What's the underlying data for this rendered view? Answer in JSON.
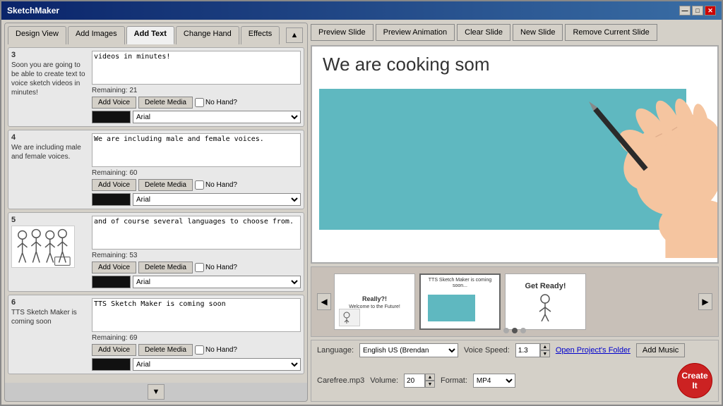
{
  "window": {
    "title": "SketchMaker",
    "buttons": {
      "minimize": "—",
      "maximize": "□",
      "close": "✕"
    }
  },
  "tabs": {
    "items": [
      "Design View",
      "Add Images",
      "Add Text",
      "Change Hand",
      "Effects"
    ],
    "active": "Add Text"
  },
  "toolbar": {
    "preview_slide": "Preview Slide",
    "preview_animation": "Preview Animation",
    "clear_slide": "Clear Slide",
    "new_slide": "New Slide",
    "remove_slide": "Remove Current Slide"
  },
  "slides": [
    {
      "number": "3",
      "left_text": "Soon you are going to be able to create text to voice sketch videos in minutes!",
      "textarea": "videos in minutes!",
      "remaining": "Remaining: 21",
      "font": "Arial",
      "has_image": false
    },
    {
      "number": "4",
      "left_text": "We are including male and female voices.",
      "textarea": "We are including male and female voices.",
      "remaining": "Remaining: 60",
      "font": "Arial",
      "has_image": false
    },
    {
      "number": "5",
      "left_text": "",
      "textarea": "and of course several languages to choose from.",
      "remaining": "Remaining: 53",
      "font": "Arial",
      "has_image": true
    },
    {
      "number": "6",
      "left_text": "TTS Sketch Maker is coming soon",
      "textarea": "TTS Sketch Maker is coming soon",
      "remaining": "Remaining: 69",
      "font": "Arial",
      "has_image": false
    }
  ],
  "preview": {
    "text": "We are cooking som"
  },
  "thumbnails": [
    {
      "label": "Really?!\nWelcome to the Future!",
      "type": "text"
    },
    {
      "label": "TTS Sketch Maker is coming soon...",
      "type": "teal"
    },
    {
      "label": "Get Ready!",
      "type": "figure"
    }
  ],
  "dots": [
    false,
    true,
    false
  ],
  "bottom_bar": {
    "language_label": "Language:",
    "language_value": "English US (Brendan",
    "voice_speed_label": "Voice Speed:",
    "voice_speed_value": "1.3",
    "open_folder": "Open Project's Folder",
    "add_music": "Add Music",
    "music_file": "Carefree.mp3",
    "volume_label": "Volume:",
    "volume_value": "20",
    "format_label": "Format:",
    "format_value": "MP4",
    "create_label": "Create It"
  },
  "buttons": {
    "add_voice": "Add Voice",
    "delete_media": "Delete Media",
    "no_hand": "No Hand?",
    "scroll_up": "▲",
    "scroll_down": "▼",
    "nav_left": "◀",
    "nav_right": "▶"
  }
}
